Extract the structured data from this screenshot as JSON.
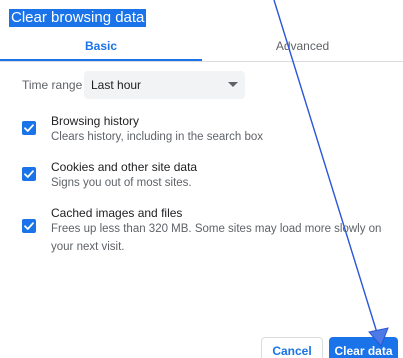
{
  "dialog": {
    "title": "Clear browsing data"
  },
  "tabs": [
    {
      "label": "Basic",
      "active": true
    },
    {
      "label": "Advanced",
      "active": false
    }
  ],
  "time_range": {
    "label": "Time range",
    "selected": "Last hour"
  },
  "options": [
    {
      "title": "Browsing history",
      "description": "Clears history, including in the search box",
      "checked": true
    },
    {
      "title": "Cookies and other site data",
      "description": "Signs you out of most sites.",
      "checked": true
    },
    {
      "title": "Cached images and files",
      "description": "Frees up less than 320 MB. Some sites may load more slowly on your next visit.",
      "checked": true
    }
  ],
  "buttons": {
    "cancel": "Cancel",
    "clear": "Clear data"
  },
  "colors": {
    "accent": "#1a73e8",
    "annotation_arrow": "#2a56d8"
  }
}
